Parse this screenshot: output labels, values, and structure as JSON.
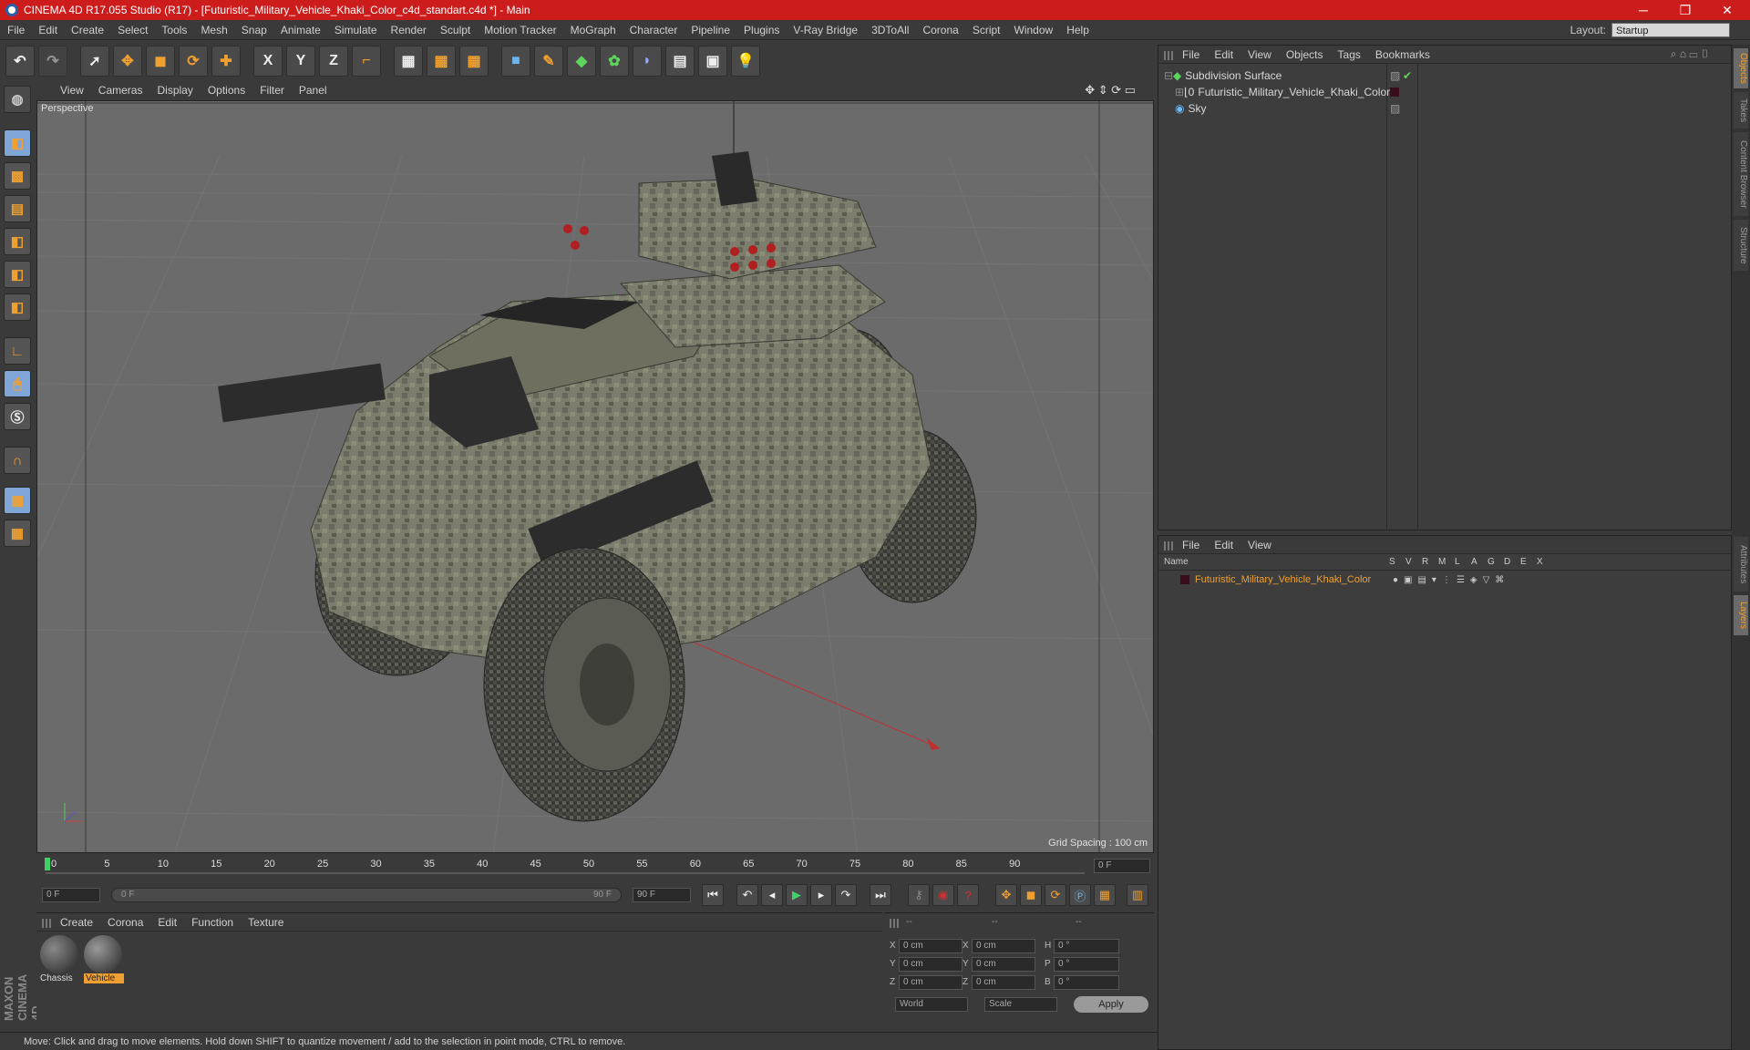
{
  "window": {
    "title": "CINEMA 4D R17.055 Studio (R17) - [Futuristic_Military_Vehicle_Khaki_Color_c4d_standart.c4d *] - Main"
  },
  "menu": [
    "File",
    "Edit",
    "Create",
    "Select",
    "Tools",
    "Mesh",
    "Snap",
    "Animate",
    "Simulate",
    "Render",
    "Sculpt",
    "Motion Tracker",
    "MoGraph",
    "Character",
    "Pipeline",
    "Plugins",
    "V-Ray Bridge",
    "3DToAll",
    "Corona",
    "Script",
    "Window",
    "Help"
  ],
  "layout": {
    "label": "Layout:",
    "value": "Startup"
  },
  "toolbar": {
    "axis_x": "X",
    "axis_y": "Y",
    "axis_z": "Z"
  },
  "viewport": {
    "menu": [
      "View",
      "Cameras",
      "Display",
      "Options",
      "Filter",
      "Panel"
    ],
    "label": "Perspective",
    "grid_spacing": "Grid Spacing : 100 cm"
  },
  "timeline": {
    "ticks": [
      "0",
      "5",
      "10",
      "15",
      "20",
      "25",
      "30",
      "35",
      "40",
      "45",
      "50",
      "55",
      "60",
      "65",
      "70",
      "75",
      "80",
      "85",
      "90"
    ],
    "current_frame": "0 F",
    "start_field": "0 F",
    "range_start": "0 F",
    "range_end": "90 F",
    "end_field": "90 F"
  },
  "materials": {
    "menu": [
      "Create",
      "Corona",
      "Edit",
      "Function",
      "Texture"
    ],
    "items": [
      {
        "name": "Chassis"
      },
      {
        "name": "Vehicle"
      }
    ]
  },
  "coords": {
    "headers": [
      "--",
      "--",
      "--"
    ],
    "rows": [
      {
        "a": "X",
        "v1": "0 cm",
        "b": "X",
        "v2": "0 cm",
        "c": "H",
        "v3": "0 °"
      },
      {
        "a": "Y",
        "v1": "0 cm",
        "b": "Y",
        "v2": "0 cm",
        "c": "P",
        "v3": "0 °"
      },
      {
        "a": "Z",
        "v1": "0 cm",
        "b": "Z",
        "v2": "0 cm",
        "c": "B",
        "v3": "0 °"
      }
    ],
    "world": "World",
    "scale": "Scale",
    "apply": "Apply"
  },
  "status": "Move: Click and drag to move elements. Hold down SHIFT to quantize movement / add to the selection in point mode, CTRL to remove.",
  "object_manager": {
    "menu": [
      "File",
      "Edit",
      "View",
      "Objects",
      "Tags",
      "Bookmarks"
    ],
    "objects": [
      {
        "name": "Subdivision Surface"
      },
      {
        "name": "Futuristic_Military_Vehicle_Khaki_Color"
      },
      {
        "name": "Sky"
      }
    ]
  },
  "layer_manager": {
    "menu": [
      "File",
      "Edit",
      "View"
    ],
    "columns": [
      "Name",
      "S",
      "V",
      "R",
      "M",
      "L",
      "A",
      "G",
      "D",
      "E",
      "X"
    ],
    "layers": [
      {
        "name": "Futuristic_Military_Vehicle_Khaki_Color"
      }
    ]
  },
  "right_tabs": [
    "Objects",
    "Takes",
    "Content Browser",
    "Structure",
    "Attributes",
    "Layers"
  ],
  "brand": "MAXON CINEMA 4D",
  "colors": {
    "titlebar": "#cc1c1c",
    "accent": "#f0a030",
    "selected_layer": "#f0a030"
  }
}
